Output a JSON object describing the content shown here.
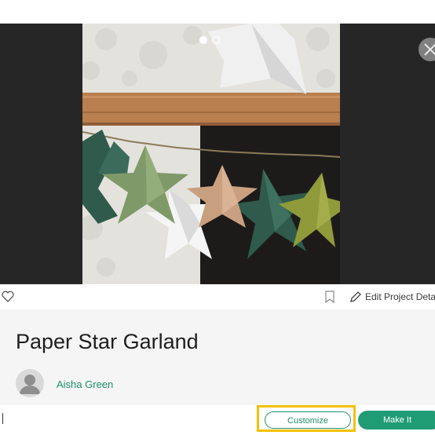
{
  "project": {
    "title": "Paper Star Garland",
    "author": "Aisha Green"
  },
  "gallery": {
    "image_count": 2,
    "active_index": 1
  },
  "actions": {
    "edit_label": "Edit Project Deta"
  },
  "buttons": {
    "customize": "Customize",
    "make_it": "Make It"
  },
  "colors": {
    "accent": "#1f9c74",
    "link": "#1f8f6b",
    "highlight": "#f3c100"
  },
  "icons": [
    "heart-icon",
    "bookmark-icon",
    "pencil-icon",
    "close-icon",
    "avatar-icon"
  ]
}
